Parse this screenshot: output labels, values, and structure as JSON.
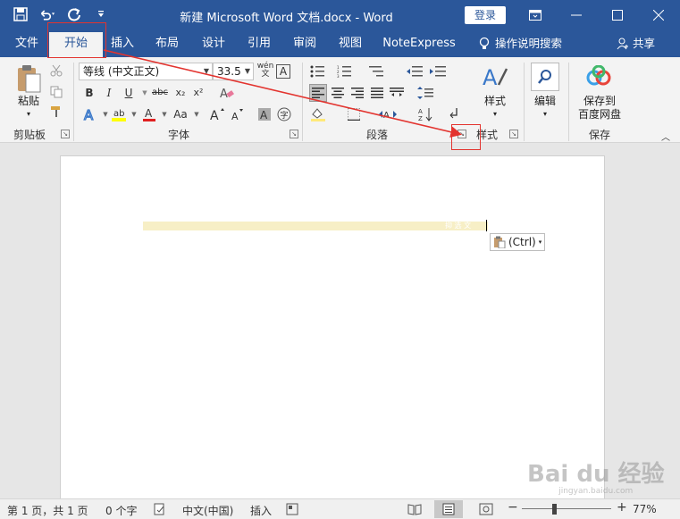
{
  "titlebar": {
    "doc_title": "新建 Microsoft Word 文档.docx  -  Word",
    "login_label": "登录"
  },
  "tabs": [
    "文件",
    "开始",
    "插入",
    "布局",
    "设计",
    "引用",
    "审阅",
    "视图",
    "NoteExpress"
  ],
  "active_tab": "开始",
  "tell_me": "操作说明搜索",
  "share": "共享",
  "ribbon": {
    "clipboard": {
      "paste": "粘贴",
      "group": "剪贴板"
    },
    "font": {
      "font_name": "等线 (中文正文)",
      "font_size": "33.5",
      "group": "字体",
      "buttons": [
        "B",
        "I",
        "U",
        "abc",
        "x₂",
        "x²"
      ],
      "case_label": "Aa"
    },
    "paragraph": {
      "group": "段落"
    },
    "styles": {
      "label": "样式",
      "group": "样式"
    },
    "editing": {
      "label": "编辑"
    },
    "save": {
      "label_line1": "保存到",
      "label_line2": "百度网盘",
      "group": "保存"
    }
  },
  "document": {
    "paste_option": "(Ctrl)",
    "faint_text": "抑 选 文"
  },
  "statusbar": {
    "page": "第 1 页，共 1 页",
    "words": "0 个字",
    "language": "中文(中国)",
    "mode": "插入",
    "zoom": "77%"
  },
  "watermark": {
    "brand": "Bai du 经验",
    "url": "jingyan.baidu.com"
  },
  "colors": {
    "accent": "#2b579a",
    "annotation": "#e3342f",
    "highlight": "#f7efc6"
  }
}
